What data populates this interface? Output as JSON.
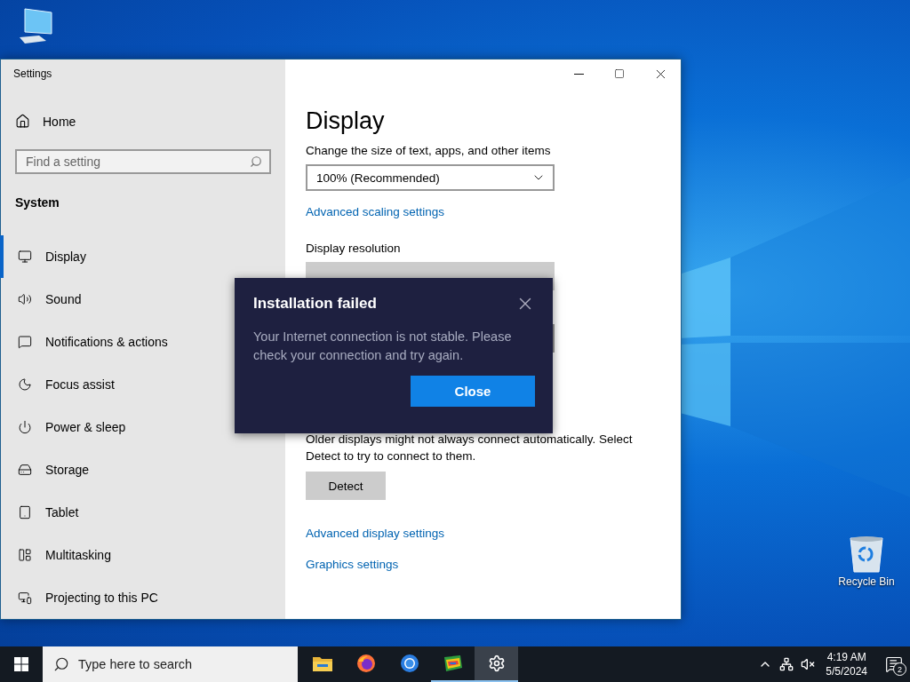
{
  "desktop_icons": [
    {
      "kind": "computer"
    },
    {
      "kind": "recycle",
      "label": "Recycle Bin"
    }
  ],
  "window": {
    "title": "Settings",
    "home": "Home",
    "search": {
      "placeholder": "Find a setting"
    },
    "section": "System",
    "nav": [
      {
        "label": "Display",
        "kind": "display",
        "selected": true
      },
      {
        "label": "Sound",
        "kind": "sound",
        "selected": false
      },
      {
        "label": "Notifications & actions",
        "kind": "notifications",
        "selected": false
      },
      {
        "label": "Focus assist",
        "kind": "focus",
        "selected": false
      },
      {
        "label": "Power & sleep",
        "kind": "power",
        "selected": false
      },
      {
        "label": "Storage",
        "kind": "storage",
        "selected": false
      },
      {
        "label": "Tablet",
        "kind": "tablet",
        "selected": false
      },
      {
        "label": "Multitasking",
        "kind": "multitasking",
        "selected": false
      },
      {
        "label": "Projecting to this PC",
        "kind": "projecting",
        "selected": false
      }
    ]
  },
  "content": {
    "heading": "Display",
    "scale_label": "Change the size of text, apps, and other items",
    "scale_value": "100% (Recommended)",
    "scaling_link": "Advanced scaling settings",
    "resolution_label": "Display resolution",
    "detect_text": "Older displays might not always connect automatically. Select Detect to try to connect to them.",
    "detect_button": "Detect",
    "links": [
      "Advanced display settings",
      "Graphics settings"
    ]
  },
  "dialog": {
    "title": "Installation failed",
    "message": "Your Internet connection is not stable. Please check your connection and try again.",
    "button": "Close"
  },
  "taskbar": {
    "search_placeholder": "Type here to search",
    "apps": [
      {
        "kind": "folder",
        "running": false,
        "selected": false
      },
      {
        "kind": "firefox",
        "running": false,
        "selected": false
      },
      {
        "kind": "chrome",
        "running": false,
        "selected": false
      },
      {
        "kind": "bluestacks",
        "running": true,
        "selected": false
      },
      {
        "kind": "settings",
        "running": true,
        "selected": true
      }
    ],
    "time": "4:19 AM",
    "date": "5/5/2024",
    "notifications": "2"
  }
}
